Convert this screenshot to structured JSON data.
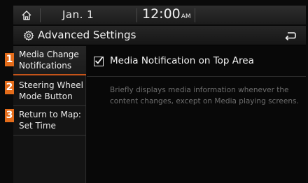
{
  "status_bar": {
    "date": "Jan.  1",
    "time": "12:00",
    "ampm": "AM"
  },
  "title_bar": {
    "title": "Advanced Settings"
  },
  "sidebar": {
    "items": [
      {
        "badge": "1",
        "label": "Media Change Notifications"
      },
      {
        "badge": "2",
        "label": "Steering Wheel Mode Button"
      },
      {
        "badge": "3",
        "label": "Return to Map: Set Time"
      }
    ]
  },
  "main": {
    "option_label": "Media Notification on Top Area",
    "option_checked": true,
    "description": "Briefly displays media information whenever the content changes, except on Media playing screens."
  },
  "colors": {
    "accent": "#e46c1a",
    "selected_underline": "#c6541a",
    "description_text": "#6d6d6d"
  }
}
